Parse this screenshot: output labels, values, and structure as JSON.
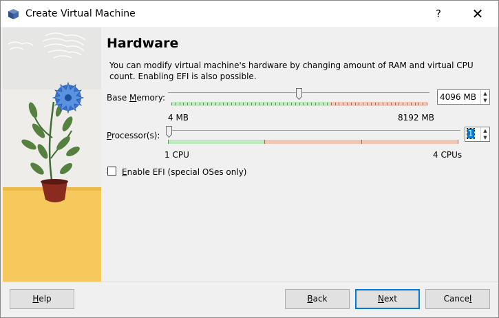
{
  "window": {
    "title": "Create Virtual Machine",
    "help_symbol": "?",
    "close_symbol": "✕"
  },
  "page": {
    "heading": "Hardware",
    "description": "You can modify virtual machine's hardware by changing amount of RAM and virtual CPU count. Enabling EFI is also possible."
  },
  "memory": {
    "label_pre": "Base ",
    "label_mnemonic": "M",
    "label_post": "emory:",
    "value": "4096 MB",
    "min_label": "4 MB",
    "max_label": "8192 MB",
    "position_fraction": 0.5,
    "green_fraction": 0.62
  },
  "processors": {
    "label_mnemonic": "P",
    "label_post": "rocessor(s):",
    "value": "1",
    "min_label": "1 CPU",
    "max_label": "4 CPUs",
    "position_fraction": 0.0,
    "green_fraction": 0.33
  },
  "efi": {
    "label_mnemonic": "E",
    "label_post": "nable EFI (special OSes only)",
    "checked": false
  },
  "buttons": {
    "help_mnemonic": "H",
    "help_post": "elp",
    "back_mnemonic": "B",
    "back_post": "ack",
    "next_mnemonic": "N",
    "next_post": "ext",
    "cancel_pre": "Cance",
    "cancel_mnemonic": "l"
  },
  "colors": {
    "scale_green": "#bfeabf",
    "scale_red": "#f3c6b6",
    "accent": "#0078d7"
  },
  "icons": {
    "app": "virtualbox-cube-icon",
    "spin_up": "spin-up-arrow-icon",
    "spin_down": "spin-down-arrow-icon"
  }
}
